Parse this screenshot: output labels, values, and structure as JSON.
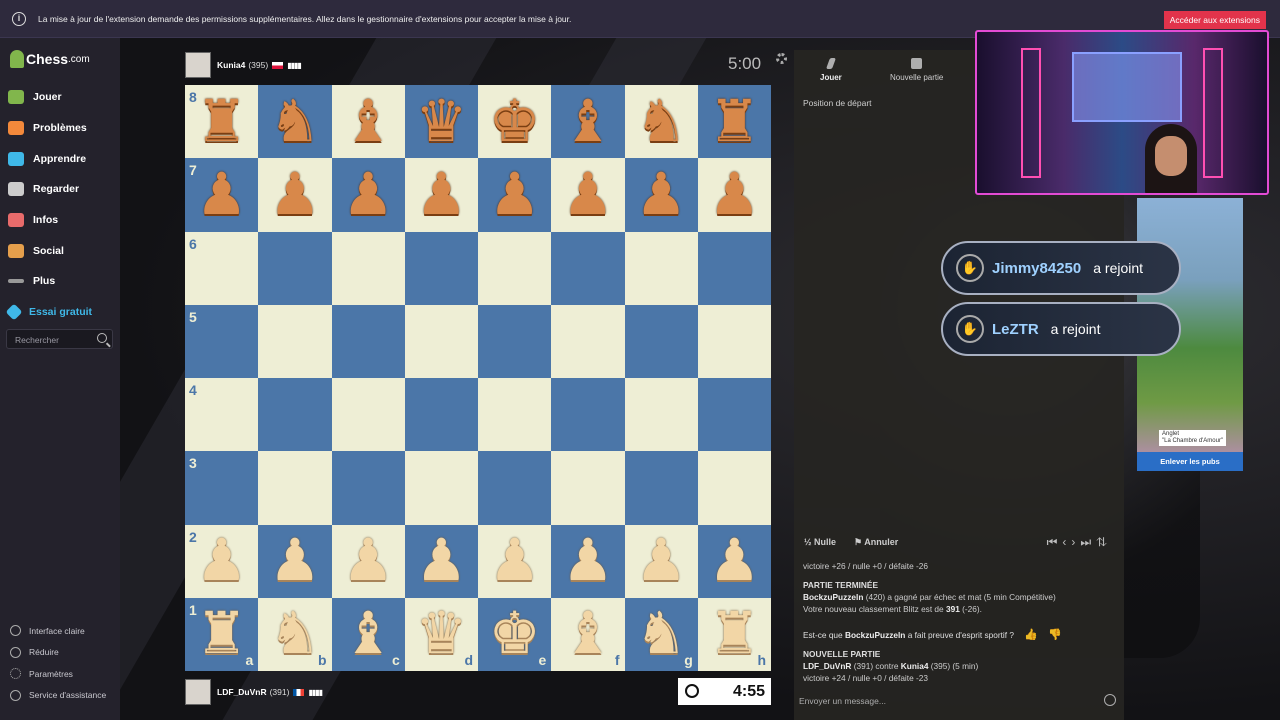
{
  "notification": {
    "message": "La mise à jour de l'extension demande des permissions supplémentaires. Allez dans le gestionnaire d'extensions pour accepter la mise à jour.",
    "button": "Accéder aux extensions"
  },
  "logo": {
    "main": "Chess",
    "suffix": ".com"
  },
  "nav": [
    {
      "label": "Jouer",
      "icon": "pawn-icon",
      "color": "#81b64c"
    },
    {
      "label": "Problèmes",
      "icon": "puzzle-icon",
      "color": "#f3893b"
    },
    {
      "label": "Apprendre",
      "icon": "learn-icon",
      "color": "#3fb8e8"
    },
    {
      "label": "Regarder",
      "icon": "binoculars-icon",
      "color": "#cccccc"
    },
    {
      "label": "Infos",
      "icon": "news-icon",
      "color": "#e86b6b"
    },
    {
      "label": "Social",
      "icon": "social-icon",
      "color": "#e59f4c"
    },
    {
      "label": "Plus",
      "icon": "more-icon",
      "color": "#999999"
    },
    {
      "label": "Essai gratuit",
      "icon": "diamond-icon",
      "color": "#3fb8e8"
    }
  ],
  "search": {
    "placeholder": "Rechercher"
  },
  "bottom_nav": [
    {
      "label": "Interface claire",
      "icon": "theme-icon"
    },
    {
      "label": "Réduire",
      "icon": "collapse-icon"
    },
    {
      "label": "Paramètres",
      "icon": "gear-icon"
    },
    {
      "label": "Service d'assistance",
      "icon": "help-icon"
    }
  ],
  "top_player": {
    "name": "Kunia4",
    "rating": "(395)",
    "bars": "▮▮▮▮",
    "clock": "5:00"
  },
  "bottom_player": {
    "name": "LDF_DuVnR",
    "rating": "(391)",
    "bars": "▮▮▮▮",
    "clock": "4:55"
  },
  "board": {
    "ranks": [
      "8",
      "7",
      "6",
      "5",
      "4",
      "3",
      "2",
      "1"
    ],
    "files": [
      "a",
      "b",
      "c",
      "d",
      "e",
      "f",
      "g",
      "h"
    ],
    "rows": [
      [
        "bR",
        "bN",
        "bB",
        "bQ",
        "bK",
        "bB",
        "bN",
        "bR"
      ],
      [
        "bP",
        "bP",
        "bP",
        "bP",
        "bP",
        "bP",
        "bP",
        "bP"
      ],
      [
        "",
        "",
        "",
        "",
        "",
        "",
        "",
        ""
      ],
      [
        "",
        "",
        "",
        "",
        "",
        "",
        "",
        ""
      ],
      [
        "",
        "",
        "",
        "",
        "",
        "",
        "",
        ""
      ],
      [
        "",
        "",
        "",
        "",
        "",
        "",
        "",
        ""
      ],
      [
        "wP",
        "wP",
        "wP",
        "wP",
        "wP",
        "wP",
        "wP",
        "wP"
      ],
      [
        "wR",
        "wN",
        "wB",
        "wQ",
        "wK",
        "wB",
        "wN",
        "wR"
      ]
    ]
  },
  "panel": {
    "tabs": [
      {
        "label": "Jouer",
        "icon": "bolt-icon"
      },
      {
        "label": "Nouvelle partie",
        "icon": "plus-icon"
      }
    ],
    "position": "Position de départ",
    "nulle": "½ Nulle",
    "annuler": "Annuler",
    "chat": {
      "line0": "victoire +26 / nulle +0 / défaite -26",
      "ended_title": "PARTIE TERMINÉE",
      "ended_1_name": "BockzuPuzzeln",
      "ended_1_rest": "(420) a gagné par échec et mat (5 min Compétitive)",
      "ended_2": "Votre nouveau classement Blitz est de",
      "ended_2_val": "391",
      "ended_2_tail": "(-26).",
      "sport_q1": "Est-ce que",
      "sport_name": "BockzuPuzzeln",
      "sport_q2": "a fait preuve d'esprit sportif ?",
      "new_title": "NOUVELLE PARTIE",
      "new_1_a": "LDF_DuVnR",
      "new_1_b": "(391) contre",
      "new_1_c": "Kunia4",
      "new_1_d": "(395) (5 min)",
      "new_2": "victoire +24 / nulle +0 / défaite -23"
    },
    "chat_placeholder": "Envoyer un message..."
  },
  "toasts": [
    {
      "user": "Jimmy84250",
      "action": "a rejoint"
    },
    {
      "user": "LeZTR",
      "action": "a rejoint"
    }
  ],
  "ad": {
    "caption": "Anglet",
    "caption2": "\"La Chambre d'Amour\"",
    "remove": "Enlever les pubs"
  }
}
